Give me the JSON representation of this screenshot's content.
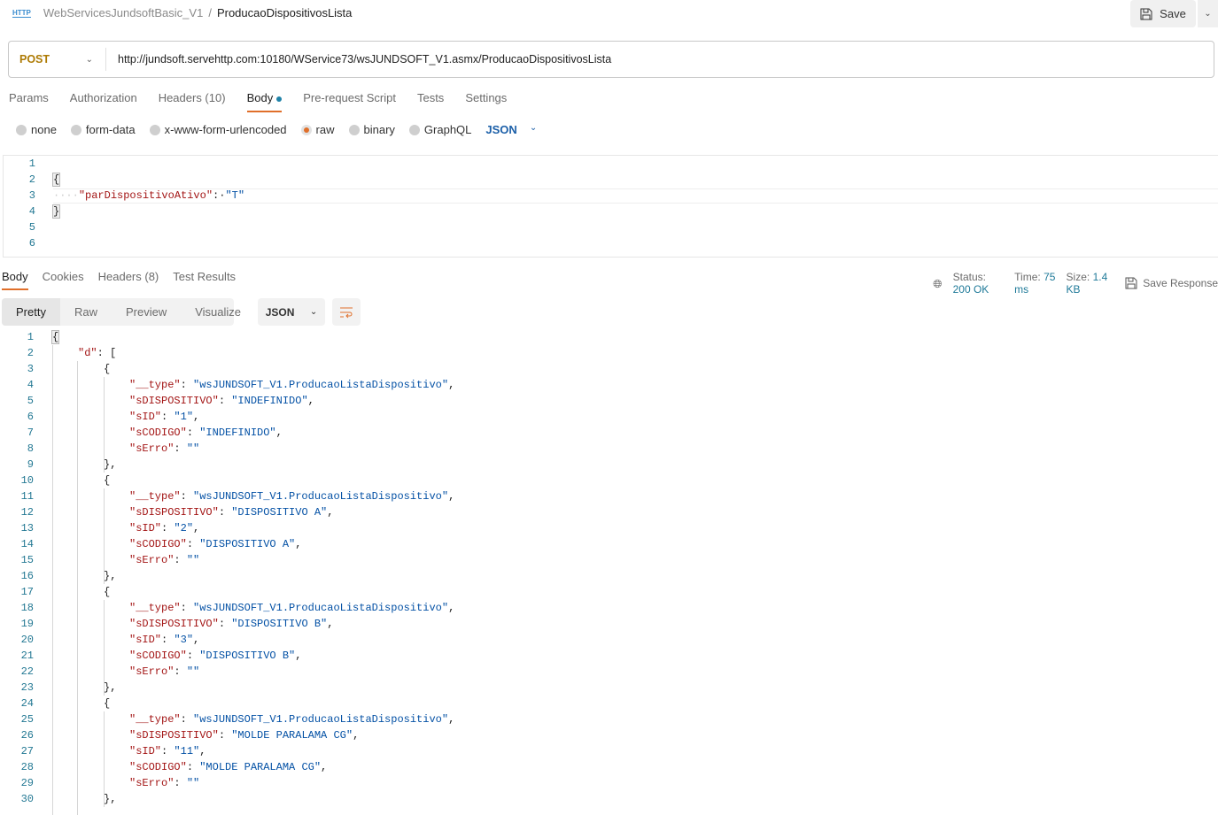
{
  "header": {
    "collection": "WebServicesJundsoftBasic_V1",
    "separator": "/",
    "request_name": "ProducaoDispositivosLista",
    "http_icon_label": "HTTP",
    "save_label": "Save"
  },
  "request": {
    "method": "POST",
    "url": "http://jundsoft.servehttp.com:10180/WService73/wsJUNDSOFT_V1.asmx/ProducaoDispositivosLista"
  },
  "tabs": [
    "Params",
    "Authorization",
    "Headers (10)",
    "Body",
    "Pre-request Script",
    "Tests",
    "Settings"
  ],
  "active_tab": "Body",
  "body_types": [
    "none",
    "form-data",
    "x-www-form-urlencoded",
    "raw",
    "binary",
    "GraphQL"
  ],
  "selected_body_type": "raw",
  "body_language": "JSON",
  "request_body": [
    [],
    [
      {
        "t": "{",
        "c": "p"
      }
    ],
    [
      {
        "t": "····",
        "c": "ws"
      },
      {
        "t": "\"parDispositivoAtivo\"",
        "c": "k"
      },
      {
        "t": ":·",
        "c": "p"
      },
      {
        "t": "\"T\"",
        "c": "s"
      }
    ],
    [
      {
        "t": "}",
        "c": "p"
      }
    ],
    [],
    []
  ],
  "response": {
    "tabs": [
      "Body",
      "Cookies",
      "Headers (8)",
      "Test Results"
    ],
    "status_label": "Status:",
    "status": "200 OK",
    "time_label": "Time:",
    "time": "75 ms",
    "size_label": "Size:",
    "size": "1.4 KB",
    "save_label": "Save Response",
    "views": [
      "Pretty",
      "Raw",
      "Preview",
      "Visualize"
    ],
    "format": "JSON",
    "items": [
      {
        "type": "wsJUNDSOFT_V1.ProducaoListaDispositivo",
        "sDISPOSITIVO": "INDEFINIDO",
        "sID": "1",
        "sCODIGO": "INDEFINIDO",
        "sErro": ""
      },
      {
        "type": "wsJUNDSOFT_V1.ProducaoListaDispositivo",
        "sDISPOSITIVO": "DISPOSITIVO A",
        "sID": "2",
        "sCODIGO": "DISPOSITIVO A",
        "sErro": ""
      },
      {
        "type": "wsJUNDSOFT_V1.ProducaoListaDispositivo",
        "sDISPOSITIVO": "DISPOSITIVO B",
        "sID": "3",
        "sCODIGO": "DISPOSITIVO B",
        "sErro": ""
      },
      {
        "type": "wsJUNDSOFT_V1.ProducaoListaDispositivo",
        "sDISPOSITIVO": "MOLDE PARALAMA CG",
        "sID": "11",
        "sCODIGO": "MOLDE PARALAMA CG",
        "sErro": ""
      }
    ]
  },
  "colors": {
    "accent": "#e06f2a",
    "method": "#ad7a03",
    "key": "#a31515",
    "string": "#0451a5",
    "line_number": "#237893"
  }
}
